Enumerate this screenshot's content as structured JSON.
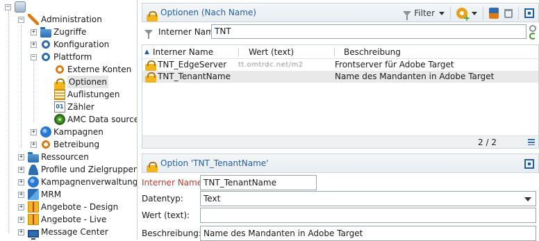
{
  "tree": {
    "root_label": "",
    "items": [
      {
        "label": "Administration",
        "expander": "−",
        "icon": "wrench-icon"
      },
      {
        "label": "Zugriffe",
        "expander": "+",
        "icon": "folder-icon"
      },
      {
        "label": "Konfiguration",
        "expander": "+",
        "icon": "gear-icon"
      },
      {
        "label": "Plattform",
        "expander": "−",
        "icon": "gear-icon"
      },
      {
        "label": "Externe Konten",
        "expander": "",
        "icon": "gear-icon"
      },
      {
        "label": "Optionen",
        "expander": "",
        "icon": "lock-icon"
      },
      {
        "label": "Auflistungen",
        "expander": "",
        "icon": "list-icon"
      },
      {
        "label": "Zähler",
        "expander": "",
        "icon": "counter-icon"
      },
      {
        "label": "AMC Data sources",
        "expander": "",
        "icon": "amc-icon"
      },
      {
        "label": "Kampagnen",
        "expander": "+",
        "icon": "globe-icon"
      },
      {
        "label": "Betreibung",
        "expander": "+",
        "icon": "gear-icon"
      },
      {
        "label": "Ressourcen",
        "expander": "+",
        "icon": "folder-icon"
      },
      {
        "label": "Profile und Zielgruppen",
        "expander": "+",
        "icon": "user-icon"
      },
      {
        "label": "Kampagnenverwaltung",
        "expander": "+",
        "icon": "globe-icon"
      },
      {
        "label": "MRM",
        "expander": "+",
        "icon": "mrm-icon"
      },
      {
        "label": "Angebote - Design",
        "expander": "+",
        "icon": "gift-icon"
      },
      {
        "label": "Angebote - Live",
        "expander": "+",
        "icon": "gift-icon"
      },
      {
        "label": "Message Center",
        "expander": "+",
        "icon": "monitor-icon"
      }
    ]
  },
  "list_panel": {
    "title": "Optionen (Nach Name)",
    "filter_button": "Filter",
    "filter_label": "Interner Name:",
    "filter_value": "TNT"
  },
  "grid": {
    "columns": [
      "Interner Name",
      "Wert (text)",
      "Beschreibung"
    ],
    "rows": [
      {
        "name": "TNT_EdgeServer",
        "value": "tt.omtrdc.net/m2",
        "description": "Frontserver für Adobe Target"
      },
      {
        "name": "TNT_TenantName",
        "value": "",
        "description": "Name des Mandanten in Adobe Target"
      }
    ],
    "count": "2 / 2"
  },
  "detail": {
    "title": "Option 'TNT_TenantName'",
    "fields": {
      "internal_name_label": "Interner Name:",
      "internal_name_value": "TNT_TenantName",
      "datatype_label": "Datentyp:",
      "datatype_value": "Text",
      "value_label": "Wert (text):",
      "value_value": "",
      "description_label": "Beschreibung:",
      "description_value": "Name des Mandanten in Adobe Target"
    }
  },
  "colors": {
    "accent": "#1f5fa8",
    "required_label": "#c0392b",
    "selected_row": "#e9e9e9"
  }
}
